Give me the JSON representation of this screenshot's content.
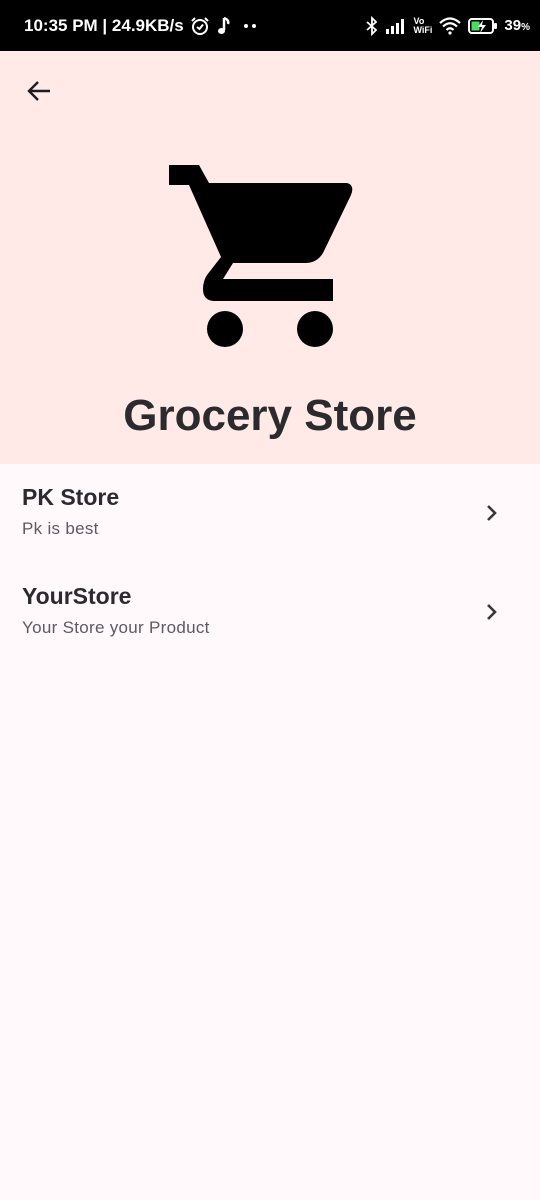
{
  "status_bar": {
    "time_speed": "10:35 PM | 24.9KB/s",
    "vo": "Vo",
    "wifi_label": "WiFi",
    "battery": "39",
    "battery_unit": "%",
    "icons": [
      "alarm-icon",
      "music-note-icon",
      "more-dots-icon",
      "bluetooth-icon",
      "signal-icon",
      "wifi-icon",
      "battery-charging-icon"
    ]
  },
  "header": {
    "title": "Grocery Store",
    "icon": "shopping-cart-icon",
    "bg_color": "#FFEAE8"
  },
  "stores": [
    {
      "name": "PK Store",
      "description": "Pk is best"
    },
    {
      "name": "YourStore",
      "description": "Your Store your Product"
    }
  ]
}
